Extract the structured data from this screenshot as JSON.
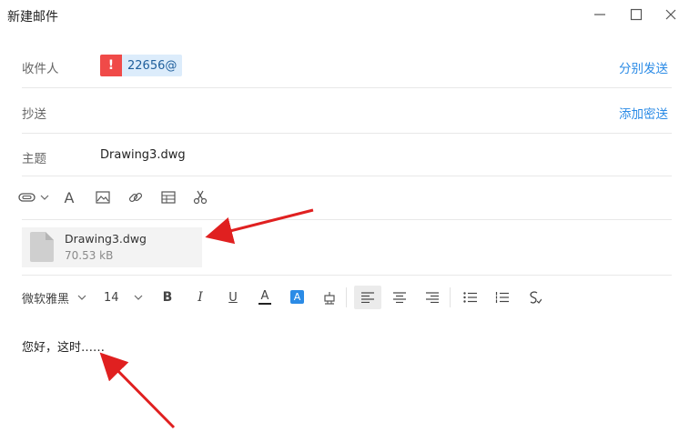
{
  "window": {
    "title": "新建邮件"
  },
  "recipient": {
    "label": "收件人",
    "chip_icon": "!",
    "chip_text": "22656@",
    "action": "分别发送"
  },
  "cc": {
    "label": "抄送",
    "action": "添加密送"
  },
  "subject": {
    "label": "主题",
    "value": "Drawing3.dwg"
  },
  "attachment": {
    "name": "Drawing3.dwg",
    "size": "70.53 kB"
  },
  "format": {
    "font": "微软雅黑",
    "size": "14",
    "bold": "B",
    "italic": "I",
    "underline": "U",
    "font_color": "A",
    "highlight": "A"
  },
  "body": {
    "text": "您好，这时……"
  },
  "colors": {
    "accent": "#2b8be6",
    "warning": "#f04a48",
    "arrow": "#e02020"
  }
}
